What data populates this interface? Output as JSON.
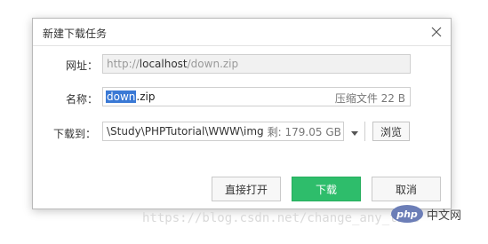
{
  "dialog": {
    "title": "新建下载任务"
  },
  "url": {
    "label": "网址：",
    "prefix": "http://",
    "host": "localhost",
    "path": "/down.zip"
  },
  "name": {
    "label": "名称：",
    "selected": "down",
    "rest": ".zip",
    "meta": "压缩文件 22 B"
  },
  "save_to": {
    "label": "下载到：",
    "path": "\\Study\\PHPTutorial\\WWW\\img",
    "free_space": "剩: 179.05 GB",
    "browse_label": "浏览"
  },
  "buttons": {
    "open_direct": "直接打开",
    "download": "下载",
    "cancel": "取消"
  },
  "watermark": {
    "text": "https://blog.csdn.net/change_any_time",
    "logo_badge": "php",
    "logo_text": "中文网"
  },
  "colors": {
    "accent_green": "#2ebd6b",
    "selection_blue": "#3a79d5"
  }
}
